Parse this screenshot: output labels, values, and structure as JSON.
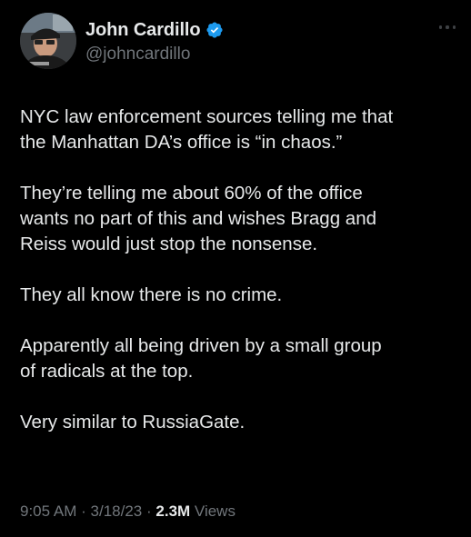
{
  "author": {
    "display_name": "John Cardillo",
    "handle": "@johncardillo",
    "verified": true,
    "avatar_icon": "profile-photo"
  },
  "tweet": {
    "paragraphs": [
      "NYC law enforcement sources telling me that\nthe Manhattan DA’s office is “in chaos.”",
      "They’re telling me about 60% of the office\nwants no part of this and wishes Bragg and\nReiss would just stop the nonsense.",
      "They all know there is no crime.",
      "Apparently all being driven by a small group\nof radicals at the top.",
      "Very similar to RussiaGate."
    ]
  },
  "meta": {
    "time": "9:05 AM",
    "separator": "·",
    "date": "3/18/23",
    "views_count": "2.3M",
    "views_label": "Views"
  },
  "colors": {
    "background": "#000000",
    "text": "#e7e9ea",
    "secondary": "#71767b",
    "verified": "#1d9bf0"
  },
  "icons": {
    "verified": "verified-badge-icon",
    "more": "more-horizontal-icon"
  }
}
